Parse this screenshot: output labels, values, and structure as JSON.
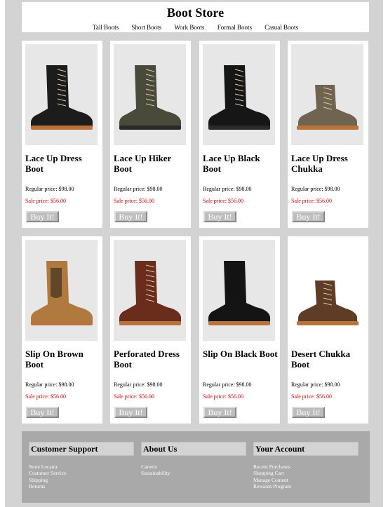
{
  "store": {
    "title": "Boot Store"
  },
  "nav": [
    "Tall Boots",
    "Short Boots",
    "Work Boots",
    "Formal Boots",
    "Casual Boots"
  ],
  "products": [
    {
      "name": "Lace Up Dress Boot",
      "regular": "Regular price: $98.00",
      "sale": "Sale price: $56.00",
      "button": "Buy It!",
      "color": "#1c1c1c",
      "style": "lace"
    },
    {
      "name": "Lace Up Hiker Boot",
      "regular": "Regular price: $98.00",
      "sale": "Sale price: $56.00",
      "button": "Buy It!",
      "color": "#4a4a3a",
      "style": "hiker"
    },
    {
      "name": "Lace Up Black Boot",
      "regular": "Regular price: $98.00",
      "sale": "Sale price: $56.00",
      "button": "Buy It!",
      "color": "#161616",
      "style": "hiker"
    },
    {
      "name": "Lace Up Dress Chukka",
      "regular": "Regular price: $98.00",
      "sale": "Sale price: $56.00",
      "button": "Buy It!",
      "color": "#6e6450",
      "style": "chukka"
    },
    {
      "name": "Slip On Brown Boot",
      "regular": "Regular price: $98.00",
      "sale": "Sale price: $56.00",
      "button": "Buy It!",
      "color": "#b07a3e",
      "style": "chelsea"
    },
    {
      "name": "Perforated Dress Boot",
      "regular": "Regular price: $98.00",
      "sale": "Sale price: $56.00",
      "button": "Buy It!",
      "color": "#6a2d1c",
      "style": "lace"
    },
    {
      "name": "Slip On Black Boot",
      "regular": "Regular price: $98.00",
      "sale": "Sale price: $56.00",
      "button": "Buy It!",
      "color": "#141414",
      "style": "chelsea"
    },
    {
      "name": "Desert Chukka Boot",
      "regular": "Regular price: $98.00",
      "sale": "Sale price: $56.00",
      "button": "Buy It!",
      "color": "#5e3c26",
      "style": "chukka"
    }
  ],
  "footer": [
    {
      "heading": "Customer Support",
      "links": [
        "Store Locator",
        "Customer Service",
        "Shipping",
        "Returns"
      ]
    },
    {
      "heading": "About Us",
      "links": [
        "Careers",
        "Sustainability"
      ]
    },
    {
      "heading": "Your Account",
      "links": [
        "Recent Purchases",
        "Shopping Cart",
        "Manage Content",
        "Rewards Program"
      ]
    }
  ]
}
